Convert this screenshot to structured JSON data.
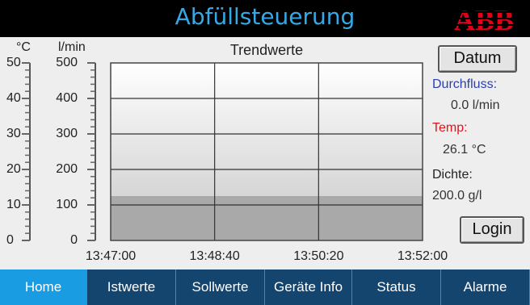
{
  "app": {
    "title": "Abfüllsteuerung",
    "brand": "ABB",
    "colors": {
      "title": "#35a9e6",
      "brand": "#e0001a",
      "active_tab": "#1a9ce3",
      "tab": "#14456f",
      "durchfluss_label": "#2a3fb0",
      "temp_label": "#e0141e"
    }
  },
  "gauge": {
    "units": {
      "left": "°C",
      "right": "l/min"
    },
    "left_ticks": [
      "50",
      "40",
      "30",
      "20",
      "10",
      "0"
    ],
    "right_ticks": [
      "500",
      "400",
      "300",
      "200",
      "100",
      "0"
    ]
  },
  "trend": {
    "title": "Trendwerte",
    "x_labels": [
      "13:47:00",
      "13:48:40",
      "13:50:20",
      "13:52:00"
    ],
    "level_fraction": 0.25
  },
  "buttons": {
    "datum": "Datum",
    "login": "Login"
  },
  "readings": {
    "durchfluss": {
      "label": "Durchfluss:",
      "value": "0.0 l/min"
    },
    "temp": {
      "label": "Temp:",
      "value": "26.1 °C"
    },
    "dichte": {
      "label": "Dichte:",
      "value": "200.0 g/l"
    }
  },
  "tabs": [
    {
      "label": "Home",
      "active": true
    },
    {
      "label": "Istwerte",
      "active": false
    },
    {
      "label": "Sollwerte",
      "active": false
    },
    {
      "label": "Geräte Info",
      "active": false
    },
    {
      "label": "Status",
      "active": false
    },
    {
      "label": "Alarme",
      "active": false
    }
  ]
}
